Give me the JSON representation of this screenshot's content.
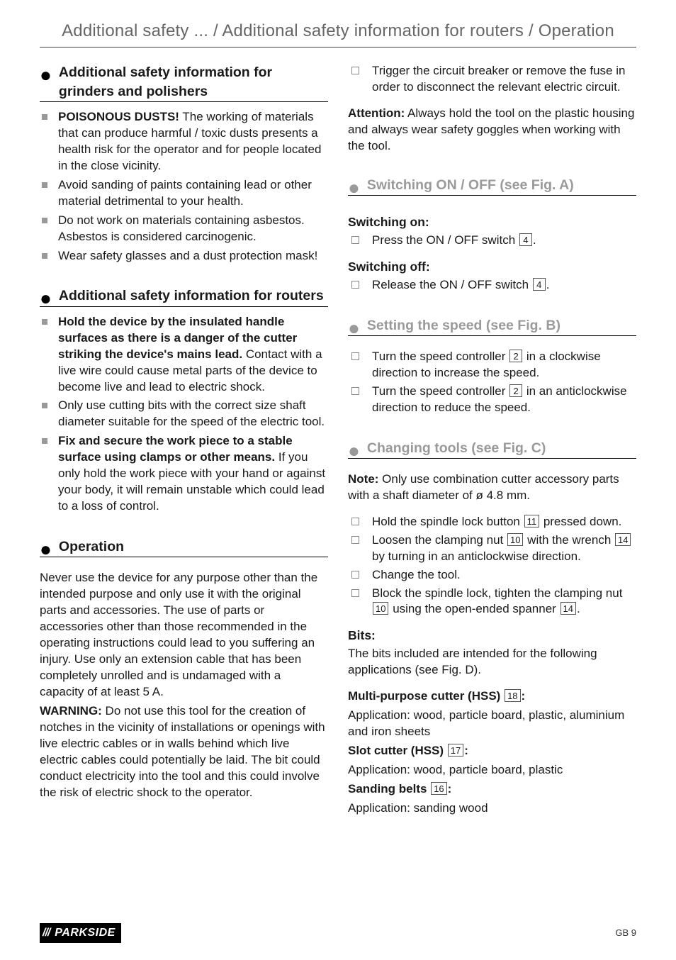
{
  "header": "Additional safety ... / Additional safety information for routers / Operation",
  "left": {
    "sec1": {
      "title": "Additional safety information for grinders and polishers",
      "items": [
        {
          "bold": "POISONOUS DUSTS!",
          "rest": " The working of materials that can produce harmful / toxic dusts presents a health risk for the operator and for people located in the close vicinity."
        },
        {
          "bold": "",
          "rest": "Avoid sanding of paints containing lead or other material detrimental to your health."
        },
        {
          "bold": "",
          "rest": "Do not work on materials containing asbestos. Asbestos is considered carcinogenic."
        },
        {
          "bold": "",
          "rest": "Wear safety glasses and a dust protection mask!"
        }
      ]
    },
    "sec2": {
      "title": "Additional safety information for routers",
      "items": [
        {
          "bold": "Hold the device by the insulated handle surfaces as there is a danger of the cutter striking the device's mains lead.",
          "rest": " Contact with a live wire could cause metal parts of the device to become live and lead to electric shock."
        },
        {
          "bold": "",
          "rest": "Only use cutting bits with the correct size shaft diameter suitable for the speed of the electric tool."
        },
        {
          "bold": "Fix and secure the work piece to a stable surface using clamps or other means.",
          "rest": " If you only hold the work piece with your hand or against your body, it will remain unstable which could lead to a loss of control."
        }
      ]
    },
    "sec3": {
      "title": "Operation",
      "para1": "Never use the device for any purpose other than the intended purpose and only use it with the original parts and accessories. The use of parts or accessories other than those recommended in the operating instructions could lead to you suffering an injury. Use only an extension cable that has been completely unrolled and is undamaged with a capacity of at least 5 A.",
      "warn_label": "WARNING:",
      "warn_text": " Do not use this tool for the creation of notches in the vicinity of installations or openings with live electric cables or in walls behind which live electric cables could potentially be laid. The bit could conduct electricity into the tool and this could involve the risk of electric shock to the operator."
    }
  },
  "right": {
    "top_step": "Trigger the circuit breaker or remove the fuse in order to disconnect the relevant electric circuit.",
    "attention_label": "Attention:",
    "attention_text": " Always hold the tool on the plastic housing and always wear safety goggles when working with the tool.",
    "sec1": {
      "title": "Switching ON / OFF (see Fig. A)",
      "on_head": "Switching on:",
      "on_pre": "Press the ON / OFF switch ",
      "on_num": "4",
      "on_post": ".",
      "off_head": "Switching off:",
      "off_pre": "Release the ON / OFF switch ",
      "off_num": "4",
      "off_post": "."
    },
    "sec2": {
      "title": "Setting the speed (see Fig. B)",
      "s1_pre": "Turn the speed controller ",
      "s1_num": "2",
      "s1_post": " in a clockwise direction to increase the speed.",
      "s2_pre": "Turn the speed controller ",
      "s2_num": "2",
      "s2_post": " in an anticlockwise direction to reduce the speed."
    },
    "sec3": {
      "title": "Changing tools (see Fig. C)",
      "note_label": "Note:",
      "note_text": " Only use combination cutter accessory parts with a shaft diameter of ø 4.8 mm.",
      "c1_pre": "Hold the spindle lock button ",
      "c1_num": "11",
      "c1_post": " pressed down.",
      "c2_pre": "Loosen the clamping nut ",
      "c2_num1": "10",
      "c2_mid": " with the wrench ",
      "c2_num2": "14",
      "c2_post": " by turning in an anticlockwise direction.",
      "c3": "Change the tool.",
      "c4_pre": "Block the spindle lock, tighten the clamping nut ",
      "c4_num1": "10",
      "c4_mid": " using the open-ended spanner ",
      "c4_num2": "14",
      "c4_post": "."
    },
    "bits": {
      "head": "Bits:",
      "intro": "The bits included are intended for the following applications (see Fig. D).",
      "m_label_pre": "Multi-purpose cutter (HSS) ",
      "m_num": "18",
      "m_label_post": ":",
      "m_text": "Application: wood, particle board, plastic, aluminium and iron sheets",
      "s_label_pre": "Slot cutter (HSS) ",
      "s_num": "17",
      "s_label_post": ":",
      "s_text": "Application: wood, particle board, plastic",
      "b_label_pre": "Sanding belts ",
      "b_num": "16",
      "b_label_post": ":",
      "b_text": "Application: sanding wood"
    }
  },
  "footer": {
    "brand": "PARKSIDE",
    "page": "GB    9"
  }
}
